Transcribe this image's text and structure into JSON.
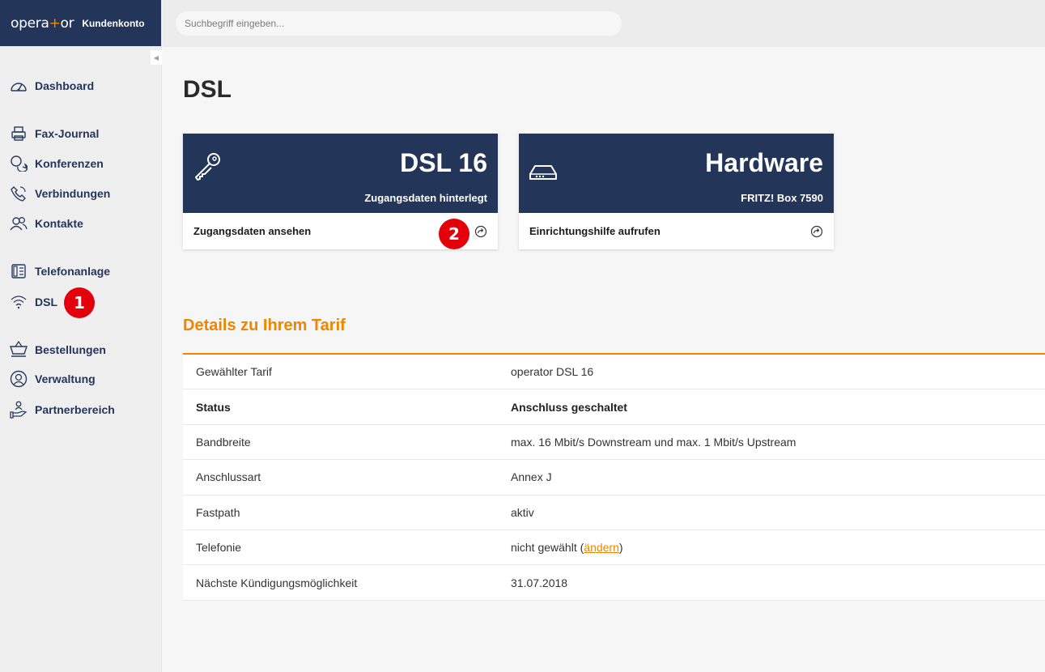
{
  "brand": {
    "logo_a": "opera",
    "logo_plus": "+",
    "logo_b": "or",
    "account": "Kundenkonto"
  },
  "search": {
    "placeholder": "Suchbegriff eingeben..."
  },
  "sidebar": {
    "items": [
      {
        "label": "Dashboard",
        "icon": "speedometer-icon"
      },
      {
        "label": "Fax-Journal",
        "icon": "printer-icon"
      },
      {
        "label": "Konferenzen",
        "icon": "chat-bubbles-icon"
      },
      {
        "label": "Verbindungen",
        "icon": "phone-icon"
      },
      {
        "label": "Kontakte",
        "icon": "users-icon"
      },
      {
        "label": "Telefonanlage",
        "icon": "phone-system-icon"
      },
      {
        "label": "DSL",
        "icon": "wifi-icon"
      },
      {
        "label": "Bestellungen",
        "icon": "cart-icon"
      },
      {
        "label": "Verwaltung",
        "icon": "user-circle-icon"
      },
      {
        "label": "Partnerbereich",
        "icon": "partner-icon"
      }
    ]
  },
  "badges": {
    "one": "1",
    "two": "2"
  },
  "page": {
    "title": "DSL"
  },
  "cards": [
    {
      "title": "DSL 16",
      "subtitle": "Zugangsdaten hinterlegt",
      "action": "Zugangsdaten ansehen",
      "icon": "key-icon"
    },
    {
      "title": "Hardware",
      "subtitle": "FRITZ! Box 7590",
      "action": "Einrichtungshilfe aufrufen",
      "icon": "router-icon"
    }
  ],
  "details": {
    "title": "Details zu Ihrem Tarif",
    "rows": [
      {
        "key": "Gewählter Tarif",
        "value": "operator DSL 16"
      },
      {
        "key": "Status",
        "value": "Anschluss geschaltet"
      },
      {
        "key": "Bandbreite",
        "value": "max. 16 Mbit/s Downstream und max. 1 Mbit/s Upstream"
      },
      {
        "key": "Anschlussart",
        "value": "Annex J"
      },
      {
        "key": "Fastpath",
        "value": "aktiv"
      },
      {
        "key": "Telefonie",
        "value": "nicht gewählt (",
        "link": "ändern",
        "value_end": ")"
      },
      {
        "key": "Nächste Kündigungsmöglichkeit",
        "value": "31.07.2018"
      }
    ]
  },
  "colors": {
    "navy": "#233558",
    "accent": "#ef8500",
    "badge_red": "#e3000b"
  }
}
